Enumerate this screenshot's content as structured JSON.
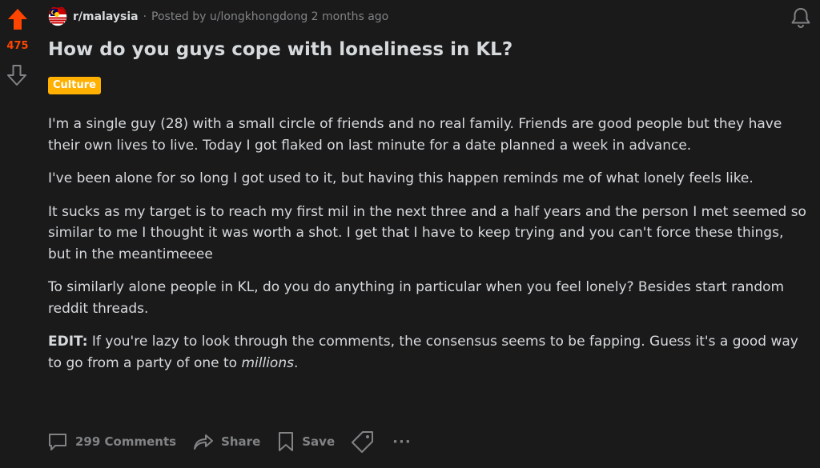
{
  "vote": {
    "score": "475"
  },
  "post": {
    "subreddit": "r/malaysia",
    "separator": "·",
    "posted_by": "Posted by u/longkhongdong 2 months ago",
    "title": "How do you guys cope with loneliness in KL?",
    "flair": "Culture",
    "paragraphs": [
      "I'm a single guy (28) with a small circle of friends and no real family. Friends are good people but they have their own lives to live. Today I got flaked on last minute for a date planned a week in advance.",
      "I've been alone for so long I got used to it, but having this happen reminds me of what lonely feels like.",
      "It sucks as my target is to reach my first mil in the next three and a half years and the person I met seemed so similar to me I thought it was worth a shot. I get that I have to keep trying and you can't force these things, but in the meantimeeee",
      "To similarly alone people in KL, do you do anything in particular when you feel lonely? Besides start random reddit threads."
    ],
    "edit": {
      "label": "EDIT:",
      "text": " If you're lazy to look through the comments, the consensus seems to be fapping. Guess it's a good way to go from a party of one to ",
      "emphasis": "millions",
      "end": "."
    }
  },
  "actions": {
    "comments": "299 Comments",
    "share": "Share",
    "save": "Save",
    "more": "···"
  },
  "colors": {
    "upvote": "#ff4500",
    "flair_bg": "#ffb000",
    "background": "#1a1a1b",
    "text": "#d7dadc",
    "muted": "#818384"
  }
}
